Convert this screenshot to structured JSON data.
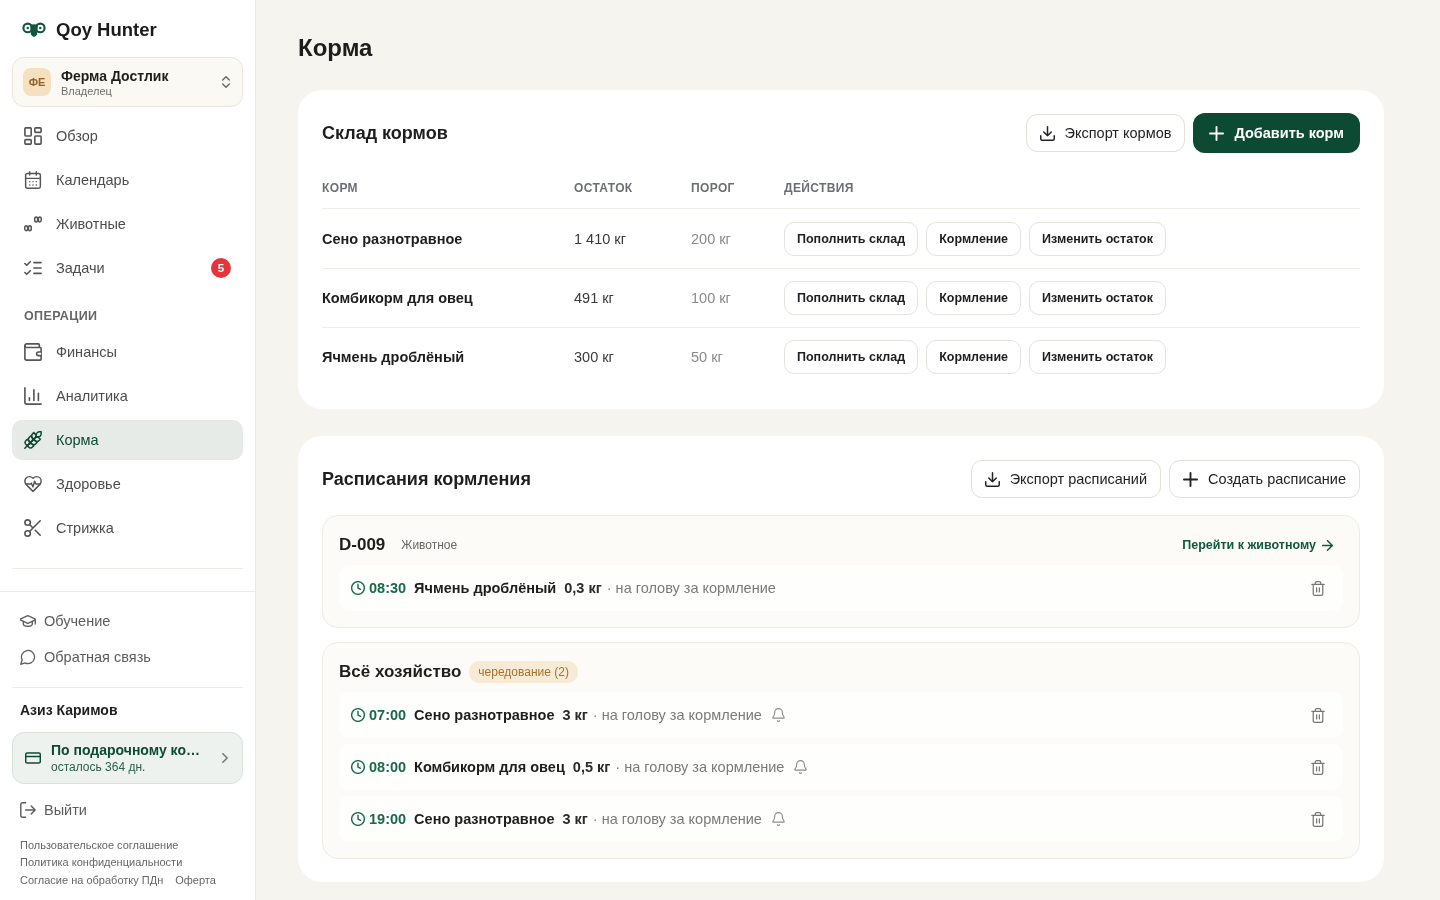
{
  "sidebar": {
    "brand": "Qoy Hunter",
    "farm": {
      "initials": "ФЕ",
      "name": "Ферма Достлик",
      "role": "Владелец"
    },
    "nav": [
      {
        "label": "Обзор",
        "selected": false
      },
      {
        "label": "Календарь",
        "selected": false
      },
      {
        "label": "Животные",
        "selected": false
      },
      {
        "label": "Задачи",
        "selected": false,
        "badge": "5"
      }
    ],
    "operations": {
      "heading": "ОПЕРАЦИИ",
      "items": [
        {
          "label": "Финансы",
          "selected": false
        },
        {
          "label": "Аналитика",
          "selected": false
        },
        {
          "label": "Корма",
          "selected": true
        },
        {
          "label": "Здоровье",
          "selected": false
        },
        {
          "label": "Стрижка",
          "selected": false
        }
      ]
    },
    "footer_links": [
      {
        "label": "Обучение"
      },
      {
        "label": "Обратная связь"
      }
    ],
    "user": {
      "name": "Азиз Каримов",
      "plan": {
        "title": "По подарочному ко…",
        "subtitle": "осталось 364 дн."
      }
    },
    "logout": "Выйти",
    "legal": [
      "Пользовательское соглашение",
      "Политика конфиденциальности",
      "Согласие на обработку ПДн",
      "Оферта"
    ]
  },
  "page_title": "Корма",
  "stock": {
    "title": "Склад кормов",
    "buttons": [
      {
        "label": "Экспорт кормов",
        "kind": "outline"
      },
      {
        "label": "Добавить корм",
        "kind": "primary"
      }
    ],
    "table": {
      "columns": [
        "КОРМ",
        "ОСТАТОК",
        "ПОРОГ",
        "ДЕЙСТВИЯ"
      ],
      "rows": [
        {
          "feed": "Сено разнотравное",
          "stock": "1 410 кг",
          "threshold": "200 кг",
          "actions": [
            "Пополнить склад",
            "Кормление",
            "Изменить остаток"
          ]
        },
        {
          "feed": "Комбикорм для овец",
          "stock": "491 кг",
          "threshold": "100 кг",
          "actions": [
            "Пополнить склад",
            "Кормление",
            "Изменить остаток"
          ]
        },
        {
          "feed": "Ячмень дроблёный",
          "stock": "300 кг",
          "threshold": "50 кг",
          "actions": [
            "Пополнить склад",
            "Кормление",
            "Изменить остаток"
          ]
        }
      ]
    }
  },
  "schedules": {
    "title": "Расписания кормления",
    "buttons": [
      {
        "label": "Экспорт расписаний",
        "kind": "outline"
      },
      {
        "label": "Создать расписание",
        "kind": "outline"
      }
    ],
    "groups": [
      {
        "title": "D-009",
        "subtitle": "Животное",
        "link": "Перейти к животному",
        "entries": [
          {
            "time": "08:30",
            "feed": "Ячмень дроблёный",
            "amount": "0,3 кг",
            "note": "· на голову за кормление",
            "reminder": false
          }
        ]
      },
      {
        "title": "Всё хозяйство",
        "badge": "чередование (2)",
        "entries": [
          {
            "time": "07:00",
            "feed": "Сено разнотравное",
            "amount": "3 кг",
            "note": "· на голову за кормление",
            "reminder": true
          },
          {
            "time": "08:00",
            "feed": "Комбикорм для овец",
            "amount": "0,5 кг",
            "note": "· на голову за кормление",
            "reminder": true
          },
          {
            "time": "19:00",
            "feed": "Сено разнотравное",
            "amount": "3 кг",
            "note": "· на голову за кормление",
            "reminder": true
          }
        ]
      }
    ]
  }
}
